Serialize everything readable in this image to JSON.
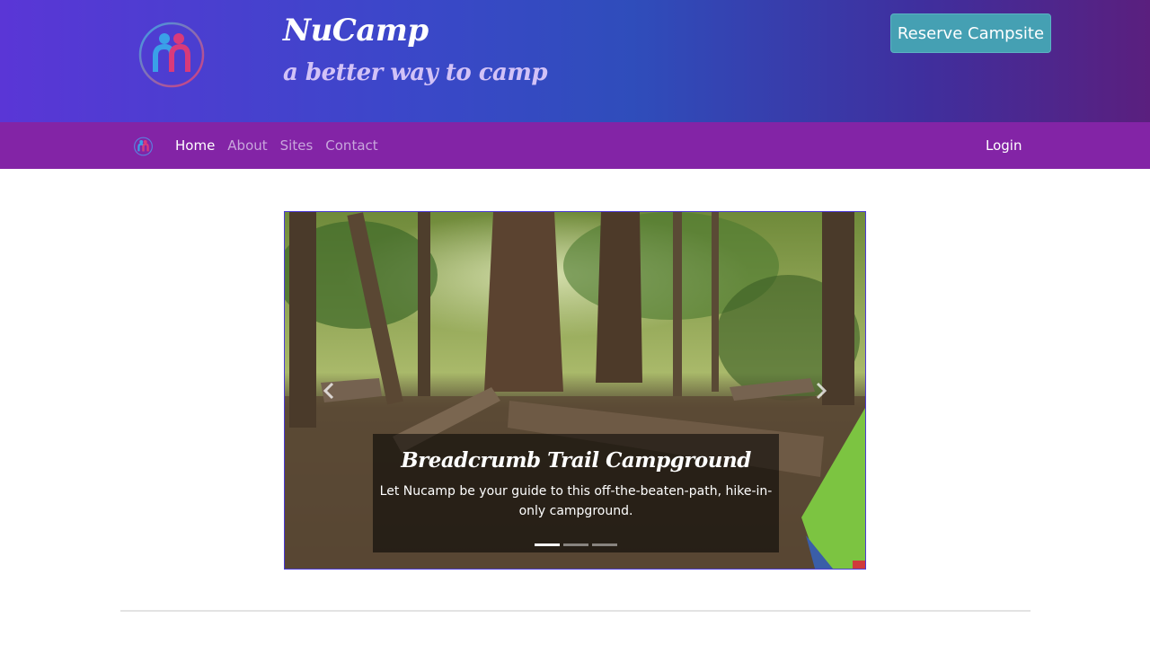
{
  "header": {
    "brand_title": "NuCamp",
    "brand_subtitle": "a better way to camp",
    "reserve_label": "Reserve Campsite",
    "logo_icon": "nucamp-logo-icon"
  },
  "nav": {
    "items": [
      {
        "label": "Home",
        "active": true
      },
      {
        "label": "About",
        "active": false
      },
      {
        "label": "Sites",
        "active": false
      },
      {
        "label": "Contact",
        "active": false
      }
    ],
    "login_label": "Login"
  },
  "carousel": {
    "slide_title": "Breadcrumb Trail Campground",
    "slide_text": "Let Nucamp be your guide to this off-the-beaten-path, hike-in-only campground.",
    "slide_count": 3,
    "active_slide": 1,
    "prev_icon": "chevron-left-icon",
    "next_icon": "chevron-right-icon"
  },
  "colors": {
    "navbar": "#8324a6",
    "reserve_button": "#45a0b3",
    "subtitle": "#d2c2f7"
  }
}
